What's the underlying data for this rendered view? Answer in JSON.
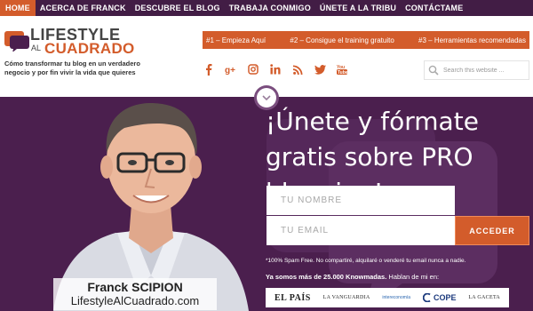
{
  "nav": {
    "items": [
      {
        "label": "HOME",
        "active": true
      },
      {
        "label": "ACERCA DE FRANCK"
      },
      {
        "label": "DESCUBRE EL BLOG"
      },
      {
        "label": "TRABAJA CONMIGO"
      },
      {
        "label": "ÚNETE A LA TRIBU"
      },
      {
        "label": "CONTÁCTAME"
      }
    ]
  },
  "logo": {
    "line1": "LIFESTYLE",
    "al": "AL",
    "line2": "CUADRADO",
    "tagline": "Cómo transformar tu blog en un verdadero negocio y por fin vivir la vida que quieres"
  },
  "orange_menu": {
    "items": [
      {
        "label": "#1 – Empieza Aquí"
      },
      {
        "label": "#2 – Consigue el training gratuito"
      },
      {
        "label": "#3 – Herramientas recomendadas"
      }
    ]
  },
  "social": {
    "icons": [
      "facebook-icon",
      "google-plus-icon",
      "instagram-icon",
      "linkedin-icon",
      "rss-icon",
      "twitter-icon",
      "youtube-icon"
    ]
  },
  "search": {
    "placeholder": "Search this website ..."
  },
  "hero": {
    "headline": "¡Únete y fórmate gratis sobre PRO blogging!",
    "name_placeholder": "TU NOMBRE",
    "email_placeholder": "TU EMAIL",
    "submit_label": "ACCEDER",
    "spam_note": "*100% Spam Free. No compartiré, alquilaré o venderé tu email nunca a nadie.",
    "press_bold": "Ya somos más de 25.000 Knowmadas.",
    "press_rest": " Hablan de mi en:",
    "caption_name": "Franck SCIPION",
    "caption_site": "LifestyleAlCuadrado.com"
  },
  "press_logos": [
    "EL PAÍS",
    "LA VANGUARDIA",
    "intereconomía",
    "COPE",
    "LA GACETA"
  ],
  "colors": {
    "nav_bg": "#421d45",
    "accent": "#d35c2b",
    "hero_bg": "#4b1f4e"
  }
}
